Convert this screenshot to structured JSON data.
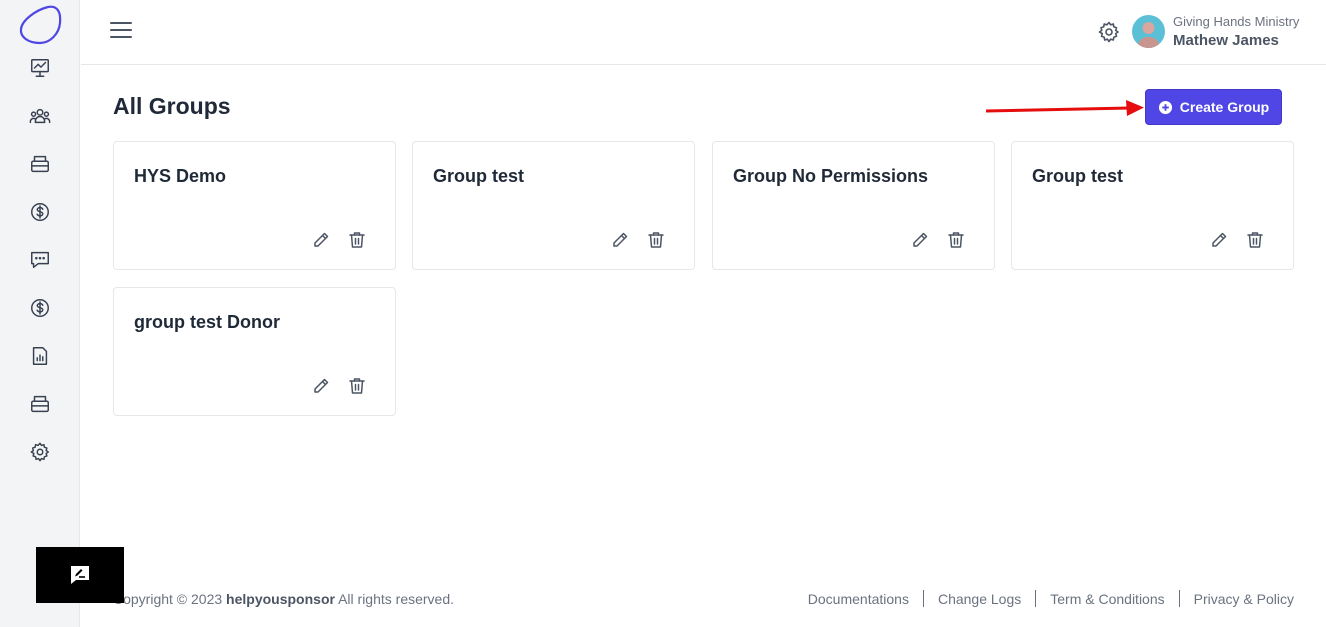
{
  "colors": {
    "accent": "#4f46e5",
    "arrow": "#e50d0d",
    "sidebar_bg": "#f3f4f6",
    "avatar": "#5bbfd6"
  },
  "sidebar": {
    "items": [
      {
        "icon": "presentation-chart-icon"
      },
      {
        "icon": "users-group-icon"
      },
      {
        "icon": "archive-box-icon"
      },
      {
        "icon": "dollar-circle-icon"
      },
      {
        "icon": "chat-bubble-icon"
      },
      {
        "icon": "dollar-circle-icon"
      },
      {
        "icon": "report-document-icon"
      },
      {
        "icon": "archive-box-icon"
      },
      {
        "icon": "gear-icon"
      }
    ]
  },
  "header": {
    "org_name": "Giving Hands Ministry",
    "user_name": "Mathew James"
  },
  "main": {
    "title": "All Groups",
    "create_button_label": "Create Group",
    "groups": [
      {
        "name": "HYS Demo"
      },
      {
        "name": "Group test"
      },
      {
        "name": "Group No Permissions"
      },
      {
        "name": "Group test"
      },
      {
        "name": "group test Donor"
      }
    ]
  },
  "footer": {
    "copyright_prefix": "Copyright © 2023",
    "brand": "helpyousponsor",
    "copyright_suffix": "All rights reserved.",
    "links": [
      "Documentations",
      "Change Logs",
      "Term & Conditions",
      "Privacy & Policy"
    ]
  }
}
